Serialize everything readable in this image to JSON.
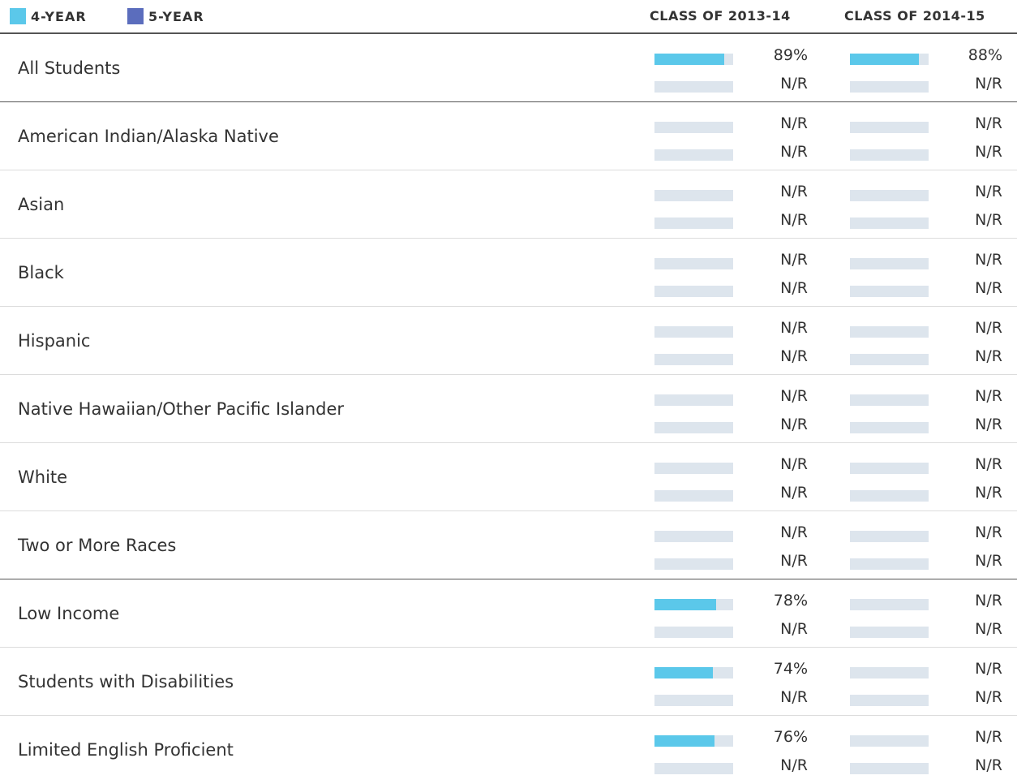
{
  "legend": [
    {
      "label": "4-YEAR",
      "color": "#5bc8ea"
    },
    {
      "label": "5-YEAR",
      "color": "#5b6dbd"
    }
  ],
  "columns": [
    "CLASS OF 2013-14",
    "CLASS OF 2014-15"
  ],
  "chart_data": {
    "type": "bar",
    "title": "",
    "categories": [
      "All Students",
      "American Indian/Alaska Native",
      "Asian",
      "Black",
      "Hispanic",
      "Native Hawaiian/Other Pacific Islander",
      "White",
      "Two or More Races",
      "Low Income",
      "Students with Disabilities",
      "Limited English Proficient"
    ],
    "ylim": [
      0,
      100
    ],
    "group_breaks_after": [
      "All Students",
      "Two or More Races"
    ],
    "panels": [
      {
        "name": "CLASS OF 2013-14",
        "series": [
          {
            "name": "4-YEAR",
            "values": [
              89,
              null,
              null,
              null,
              null,
              null,
              null,
              null,
              78,
              74,
              76
            ],
            "labels": [
              "89%",
              "N/R",
              "N/R",
              "N/R",
              "N/R",
              "N/R",
              "N/R",
              "N/R",
              "78%",
              "74%",
              "76%"
            ]
          },
          {
            "name": "5-YEAR",
            "values": [
              null,
              null,
              null,
              null,
              null,
              null,
              null,
              null,
              null,
              null,
              null
            ],
            "labels": [
              "N/R",
              "N/R",
              "N/R",
              "N/R",
              "N/R",
              "N/R",
              "N/R",
              "N/R",
              "N/R",
              "N/R",
              "N/R"
            ]
          }
        ]
      },
      {
        "name": "CLASS OF 2014-15",
        "series": [
          {
            "name": "4-YEAR",
            "values": [
              88,
              null,
              null,
              null,
              null,
              null,
              null,
              null,
              null,
              null,
              null
            ],
            "labels": [
              "88%",
              "N/R",
              "N/R",
              "N/R",
              "N/R",
              "N/R",
              "N/R",
              "N/R",
              "N/R",
              "N/R",
              "N/R"
            ]
          },
          {
            "name": "5-YEAR",
            "values": [
              null,
              null,
              null,
              null,
              null,
              null,
              null,
              null,
              null,
              null,
              null
            ],
            "labels": [
              "N/R",
              "N/R",
              "N/R",
              "N/R",
              "N/R",
              "N/R",
              "N/R",
              "N/R",
              "N/R",
              "N/R",
              "N/R"
            ]
          }
        ]
      }
    ]
  },
  "colors": {
    "track": "#dde5ed",
    "rule_dark": "#555555",
    "rule_light": "#dcdcdc"
  }
}
